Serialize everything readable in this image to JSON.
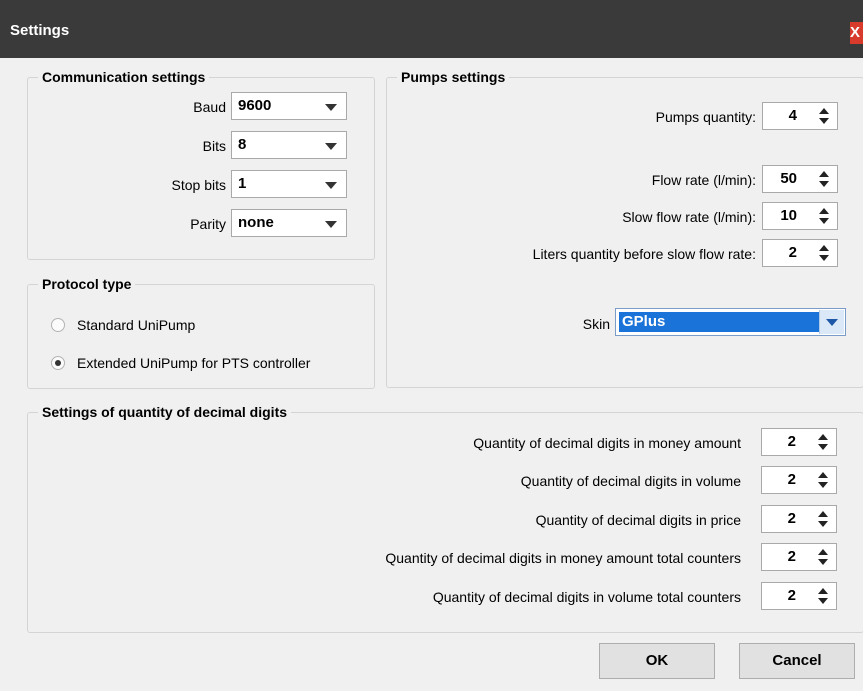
{
  "window": {
    "title": "Settings",
    "close_glyph": "X"
  },
  "communication": {
    "title": "Communication settings",
    "rows": [
      {
        "label": "Baud",
        "value": "9600"
      },
      {
        "label": "Bits",
        "value": "8"
      },
      {
        "label": "Stop bits",
        "value": "1"
      },
      {
        "label": "Parity",
        "value": "none"
      }
    ]
  },
  "protocol": {
    "title": "Protocol type",
    "options": [
      {
        "label": "Standard UniPump",
        "selected": false
      },
      {
        "label": "Extended UniPump for PTS controller",
        "selected": true
      }
    ]
  },
  "pumps": {
    "title": "Pumps settings",
    "quantity_label": "Pumps quantity:",
    "quantity": "4",
    "flow_label": "Flow rate (l/min):",
    "flow": "50",
    "slow_flow_label": "Slow flow rate (l/min):",
    "slow_flow": "10",
    "liters_label": "Liters quantity before slow flow rate:",
    "liters": "2",
    "skin_label": "Skin",
    "skin": "GPlus"
  },
  "decimal": {
    "title": "Settings of quantity of decimal digits",
    "rows": [
      {
        "label": "Quantity of decimal digits in money amount",
        "value": "2"
      },
      {
        "label": "Quantity of decimal digits in volume",
        "value": "2"
      },
      {
        "label": "Quantity of decimal digits in price",
        "value": "2"
      },
      {
        "label": "Quantity of decimal digits in money amount total counters",
        "value": "2"
      },
      {
        "label": "Quantity of decimal digits in volume total counters",
        "value": "2"
      }
    ]
  },
  "buttons": {
    "ok": "OK",
    "cancel": "Cancel"
  },
  "colors": {
    "titlebar": "#3a3a3a",
    "close": "#d83b2b",
    "selection": "#1a73d8"
  }
}
